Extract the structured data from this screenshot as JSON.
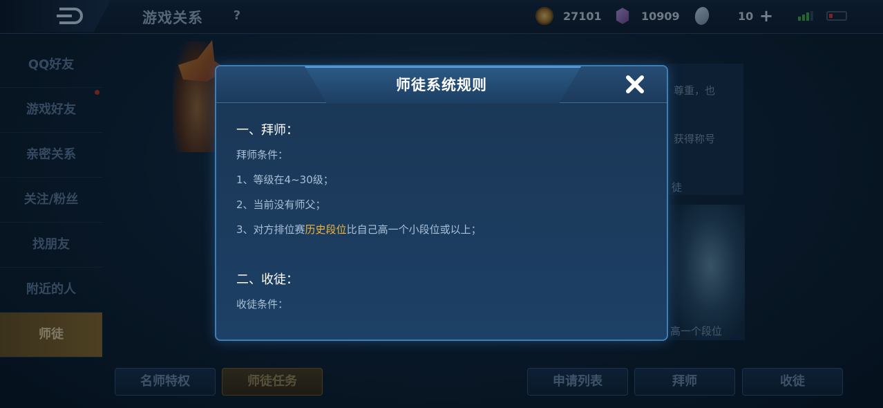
{
  "header": {
    "title": "游戏关系",
    "help_label": "?",
    "coins": "27101",
    "gems": "10909",
    "cards": "10",
    "plus_label": "+"
  },
  "sidebar": {
    "items": [
      {
        "label": "QQ好友"
      },
      {
        "label": "游戏好友"
      },
      {
        "label": "亲密关系"
      },
      {
        "label": "关注/粉丝"
      },
      {
        "label": "找朋友"
      },
      {
        "label": "附近的人"
      },
      {
        "label": "师徒"
      }
    ]
  },
  "background": {
    "right_text_1": "尊重，也",
    "right_text_2": "获得称号",
    "right_text_3": "徒",
    "right_text_4": "高一个段位"
  },
  "bottom_buttons": {
    "famous_master": "名师特权",
    "tasks": "师徒任务",
    "apply_list": "申请列表",
    "apprentice": "拜师",
    "take_disciple": "收徒"
  },
  "modal": {
    "title": "师徒系统规则",
    "section1_title": "一、拜师：",
    "conditions_label": "拜师条件：",
    "rule1": "1、等级在4~30级；",
    "rule2": "2、当前没有师父；",
    "rule3_prefix": "3、对方排位赛",
    "rule3_highlight": "历史段位",
    "rule3_suffix": "比自己高一个小段位或以上；",
    "section2_title": "二、收徒：",
    "section2_conditions": "收徒条件："
  },
  "colors": {
    "accent_gold": "#f0b43a",
    "modal_border": "#3f7fb8",
    "active_tab": "#8b6c2e"
  }
}
